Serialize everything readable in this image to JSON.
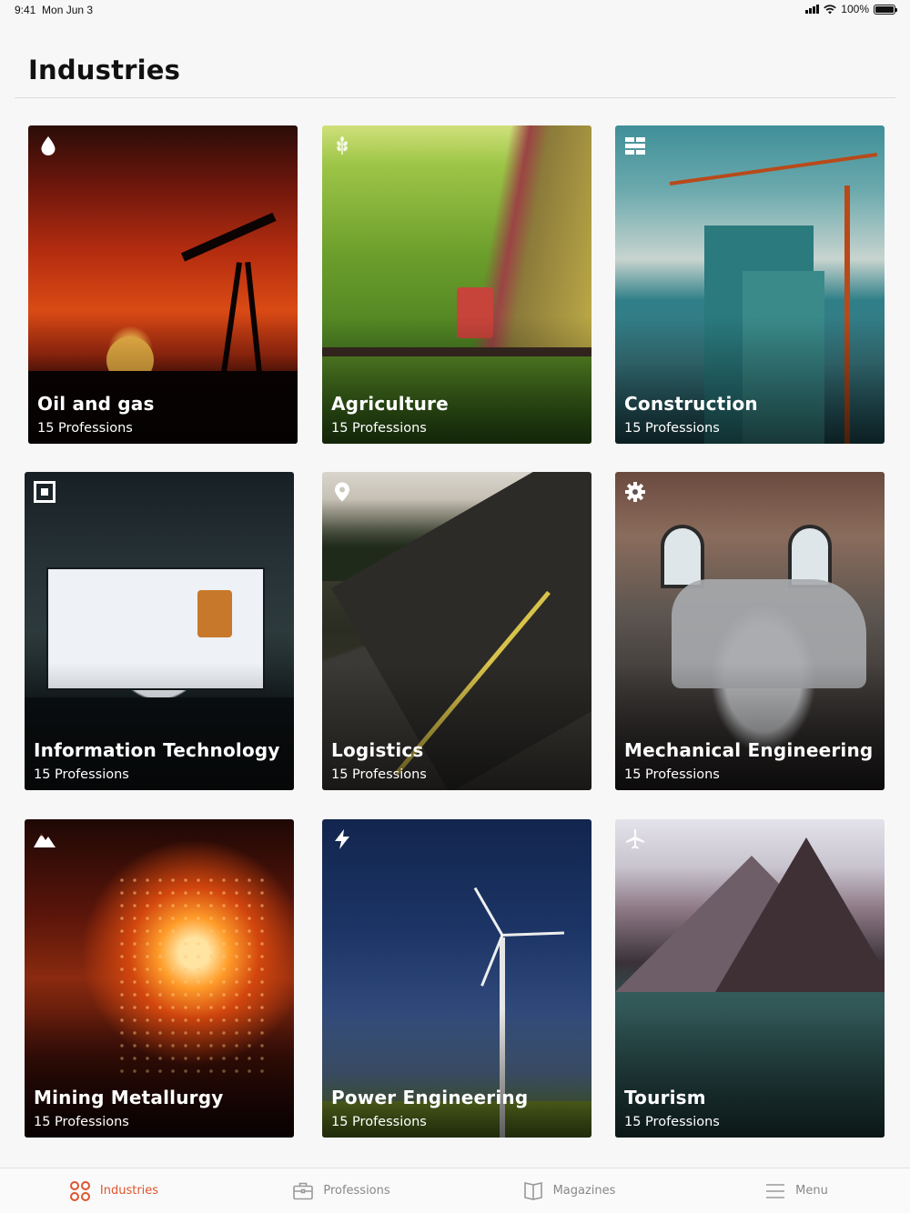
{
  "status_bar": {
    "time": "9:41",
    "date": "Mon Jun 3",
    "battery": "100%"
  },
  "header": {
    "title": "Industries"
  },
  "cards": [
    {
      "title": "Oil and gas",
      "subtitle": "15 Professions",
      "icon": "drop-icon"
    },
    {
      "title": "Agriculture",
      "subtitle": "15 Professions",
      "icon": "wheat-icon"
    },
    {
      "title": "Construction",
      "subtitle": "15 Professions",
      "icon": "bricks-icon"
    },
    {
      "title": "Information Technology",
      "subtitle": "15 Professions",
      "icon": "chip-icon"
    },
    {
      "title": "Logistics",
      "subtitle": "15 Professions",
      "icon": "location-pin-icon"
    },
    {
      "title": "Mechanical Engineering",
      "subtitle": "15 Professions",
      "icon": "gear-icon"
    },
    {
      "title": "Mining Metallurgy",
      "subtitle": "15 Professions",
      "icon": "mountain-icon"
    },
    {
      "title": "Power Engineering",
      "subtitle": "15 Professions",
      "icon": "lightning-icon"
    },
    {
      "title": "Tourism",
      "subtitle": "15 Professions",
      "icon": "airplane-icon"
    }
  ],
  "tab_bar": {
    "items": [
      {
        "label": "Industries",
        "icon": "grid-circles-icon",
        "active": true
      },
      {
        "label": "Professions",
        "icon": "briefcase-icon",
        "active": false
      },
      {
        "label": "Magazines",
        "icon": "book-icon",
        "active": false
      },
      {
        "label": "Menu",
        "icon": "menu-icon",
        "active": false
      }
    ]
  },
  "colors": {
    "accent": "#e0542c",
    "inactive": "#888888",
    "background": "#f7f7f7"
  }
}
